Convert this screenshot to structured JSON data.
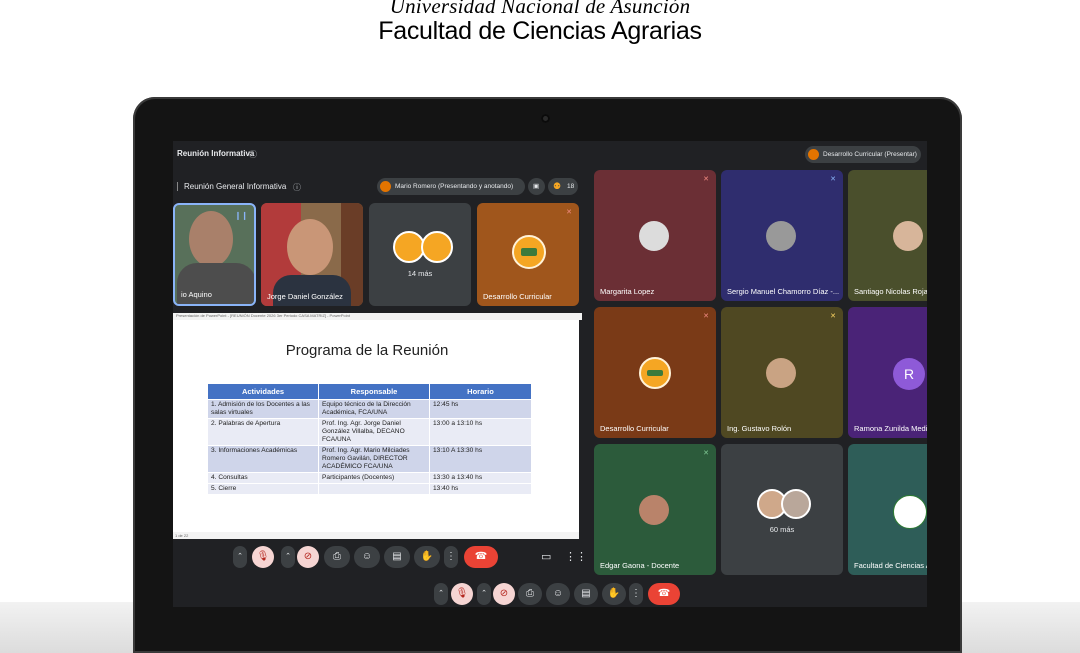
{
  "header": {
    "university": "Universidad Nacional de Asunción",
    "faculty": "Facultad de Ciencias Agrarias"
  },
  "meet": {
    "window_title": "Reunión Informativa",
    "presenting_chip": "Desarrollo Curricular (Presentar)",
    "meeting_title": "Reunión General Informativa",
    "presenter_chip": "Mario Romero (Presentando y anotando)",
    "participant_count": "18",
    "top_tiles": [
      {
        "name": "io Aquino"
      },
      {
        "name": "Jorge Daniel González"
      },
      {
        "name": "14 más"
      },
      {
        "name": "Desarrollo Curricular"
      }
    ],
    "grid_tiles": [
      {
        "name": "Margarita Lopez"
      },
      {
        "name": "Sergio Manuel Chamorro Díaz -..."
      },
      {
        "name": "Santiago Nicolas Rojas"
      },
      {
        "name": "Desarrollo Curricular"
      },
      {
        "name": "Ing. Gustavo Rolón"
      },
      {
        "name": "Ramona Zunilda Medin",
        "initial": "R"
      },
      {
        "name": "Edgar Gaona - Docente"
      },
      {
        "name": "60 más"
      },
      {
        "name": "Facultad de Ciencias A"
      }
    ],
    "accent_red": "#ea4335",
    "accent_orange": "#e37400"
  },
  "slide": {
    "app_bar": "Presentación de PowerPoint - [REUNIÓN Docente 2026 3er Periodo CASA MATRIZ] - PowerPoint",
    "title": "Programa de la Reunión",
    "headers": [
      "Actividades",
      "Responsable",
      "Horario"
    ],
    "rows": [
      [
        "1. Admisión de los Docentes a las salas virtuales",
        "Equipo técnico de la Dirección Académica, FCA/UNA",
        "12:45 hs"
      ],
      [
        "2. Palabras de Apertura",
        "Prof. Ing. Agr. Jorge Daniel González Villalba, DECANO FCA/UNA",
        "13:00 a 13:10 hs"
      ],
      [
        "3. Informaciones Académicas",
        "Prof. Ing. Agr. Mario Milciades Romero Gavilán, DIRECTOR ACADÉMICO FCA/UNA",
        "13:10 A 13:30 hs"
      ],
      [
        "4. Consultas",
        "Participantes (Docentes)",
        "13:30 a 13:40 hs"
      ],
      [
        "5. Cierre",
        "",
        "13:40 hs"
      ]
    ],
    "status_left": "1 de 22"
  }
}
